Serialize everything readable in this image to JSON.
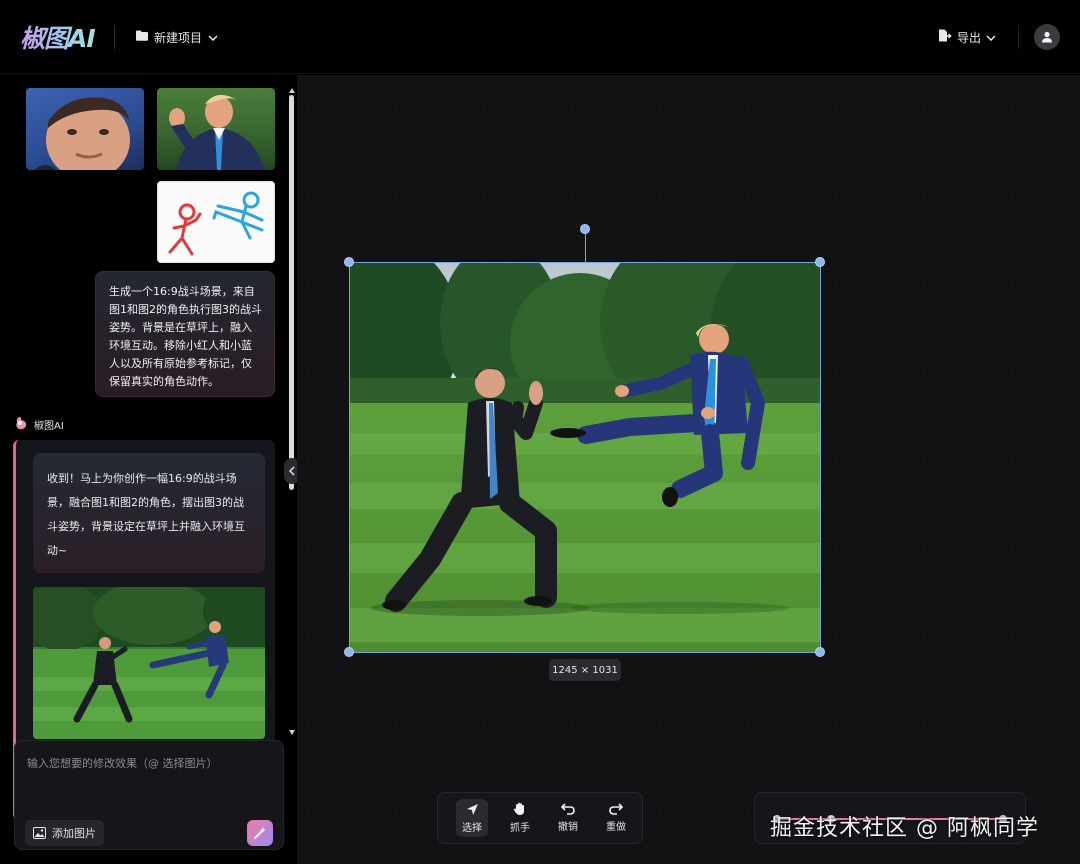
{
  "header": {
    "logo": "椒图AI",
    "project_menu": "新建项目",
    "export_menu": "导出"
  },
  "sidebar": {
    "user_message": "生成一个16:9战斗场景，来自图1和图2的角色执行图3的战斗姿势。背景是在草坪上，融入环境互动。移除小红人和小蓝人以及所有原始参考标记，仅保留真实的角色动作。",
    "ai_name": "椒图AI",
    "ai_message": "收到！马上为你创作一幅16:9的战斗场景，融合图1和图2的角色，摆出图3的战斗姿势，背景设定在草坪上并融入环境互动~"
  },
  "input": {
    "placeholder": "输入您想要的修改效果（@ 选择图片）",
    "value": "",
    "add_image_label": "添加图片"
  },
  "canvas": {
    "dimensions_label": "1245 × 1031"
  },
  "toolbar": {
    "tools": [
      {
        "label": "选择",
        "icon": "cursor-arrow-icon",
        "active": true
      },
      {
        "label": "抓手",
        "icon": "hand-icon",
        "active": false
      },
      {
        "label": "撤销",
        "icon": "undo-icon",
        "active": false
      },
      {
        "label": "重做",
        "icon": "redo-icon",
        "active": false
      }
    ]
  },
  "watermark": "掘金技术社区 @ 阿枫同学",
  "colors": {
    "background": "#000000",
    "canvas": "#121214",
    "selection": "#7aa3de",
    "accent_pink": "#d86d87",
    "accent_gradient_start": "#ef7aa6",
    "accent_gradient_end": "#9b8cf0"
  }
}
